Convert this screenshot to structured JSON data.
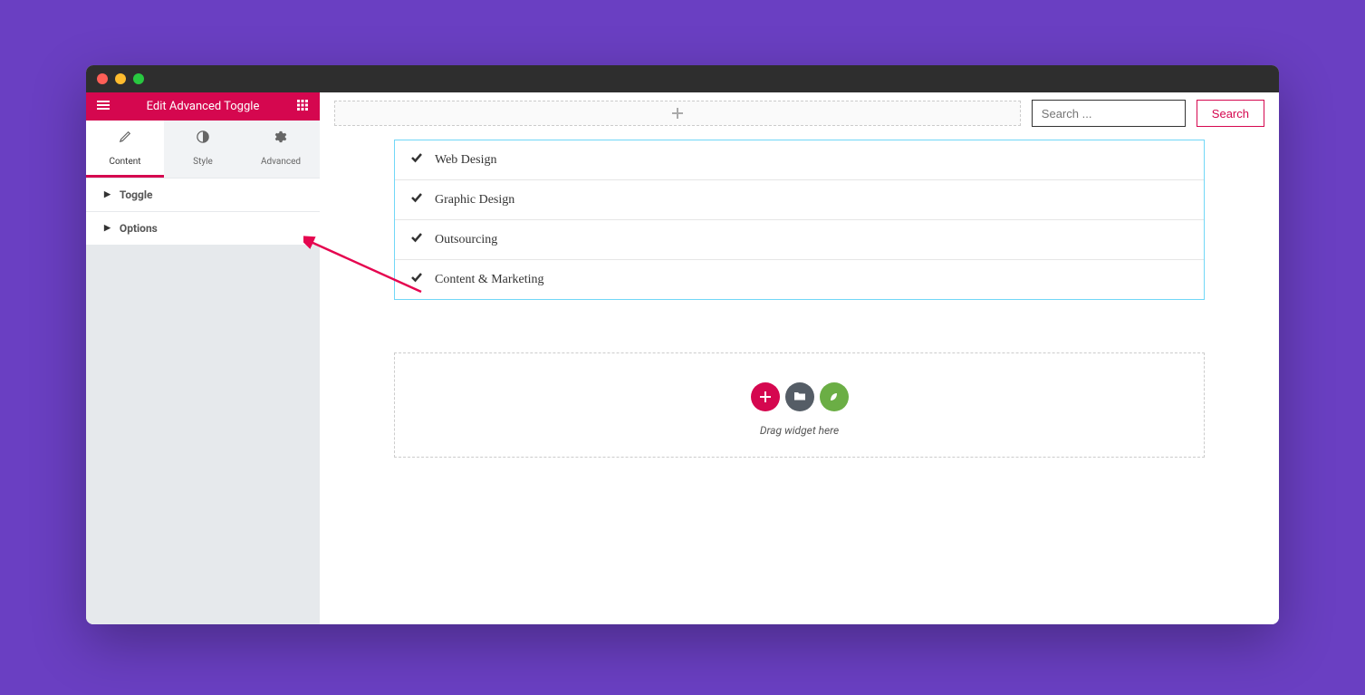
{
  "header": {
    "title": "Edit Advanced Toggle"
  },
  "tabs": {
    "content": "Content",
    "style": "Style",
    "advanced": "Advanced"
  },
  "panels": {
    "toggle": "Toggle",
    "options": "Options"
  },
  "search": {
    "placeholder": "Search ...",
    "button": "Search"
  },
  "toggle_items": [
    "Web Design",
    "Graphic Design",
    "Outsourcing",
    "Content & Marketing"
  ],
  "dropzone": {
    "caption": "Drag widget here"
  }
}
